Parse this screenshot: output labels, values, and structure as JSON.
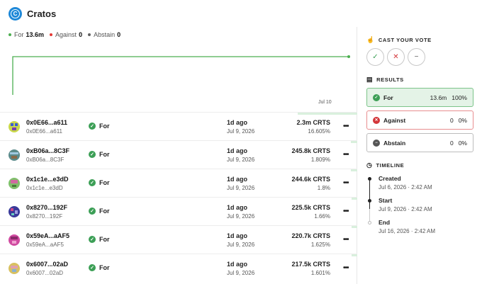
{
  "header": {
    "title": "Cratos",
    "logo_letter": "C"
  },
  "legend": [
    {
      "label": "For",
      "value": "13.6m",
      "color": "#4caf50"
    },
    {
      "label": "Against",
      "value": "0",
      "color": "#e53935"
    },
    {
      "label": "Abstain",
      "value": "0",
      "color": "#616161"
    }
  ],
  "chart_data": {
    "type": "line",
    "x": [
      "",
      "Jul 10"
    ],
    "xlabel_tick": "Jul 10",
    "series": [
      {
        "name": "For",
        "color": "#4caf50",
        "values": [
          0,
          13.6
        ]
      }
    ]
  },
  "votes": [
    {
      "address": "0x0E66...a611",
      "address_sub": "0x0E66...a611",
      "choice": "For",
      "time": "1d ago",
      "date": "Jul 9, 2026",
      "power": "2.3m CRTS",
      "percent": "16.605%",
      "share": 0.16605
    },
    {
      "address": "0xB06a...8C3F",
      "address_sub": "0xB06a...8C3F",
      "choice": "For",
      "time": "1d ago",
      "date": "Jul 9, 2026",
      "power": "245.8k CRTS",
      "percent": "1.809%",
      "share": 0.01809
    },
    {
      "address": "0x1c1e...e3dD",
      "address_sub": "0x1c1e...e3dD",
      "choice": "For",
      "time": "1d ago",
      "date": "Jul 9, 2026",
      "power": "244.6k CRTS",
      "percent": "1.8%",
      "share": 0.018
    },
    {
      "address": "0x8270...192F",
      "address_sub": "0x8270...192F",
      "choice": "For",
      "time": "1d ago",
      "date": "Jul 9, 2026",
      "power": "225.5k CRTS",
      "percent": "1.66%",
      "share": 0.0166
    },
    {
      "address": "0x59eA...aAF5",
      "address_sub": "0x59eA...aAF5",
      "choice": "For",
      "time": "1d ago",
      "date": "Jul 9, 2026",
      "power": "220.7k CRTS",
      "percent": "1.625%",
      "share": 0.01625
    },
    {
      "address": "0x6007...02aD",
      "address_sub": "0x6007...02aD",
      "choice": "For",
      "time": "1d ago",
      "date": "Jul 9, 2026",
      "power": "217.5k CRTS",
      "percent": "1.601%",
      "share": 0.01601
    }
  ],
  "sidebar": {
    "cast_vote": {
      "title": "CAST YOUR VOTE"
    },
    "results": {
      "title": "RESULTS",
      "items": [
        {
          "label": "For",
          "value": "13.6m",
          "percent": "100%"
        },
        {
          "label": "Against",
          "value": "0",
          "percent": "0%"
        },
        {
          "label": "Abstain",
          "value": "0",
          "percent": "0%"
        }
      ]
    },
    "timeline": {
      "title": "TIMELINE",
      "items": [
        {
          "label": "Created",
          "date": "Jul 6, 2026 · 2:42 AM"
        },
        {
          "label": "Start",
          "date": "Jul 9, 2026 · 2:42 AM"
        },
        {
          "label": "End",
          "date": "Jul 16, 2026 · 2:42 AM"
        }
      ]
    }
  },
  "colors": {
    "for": "#3c9f56",
    "against": "#d3363a",
    "abstain": "#555555",
    "for_bg": "#e4f3e7",
    "against_border": "#e88d8f"
  }
}
